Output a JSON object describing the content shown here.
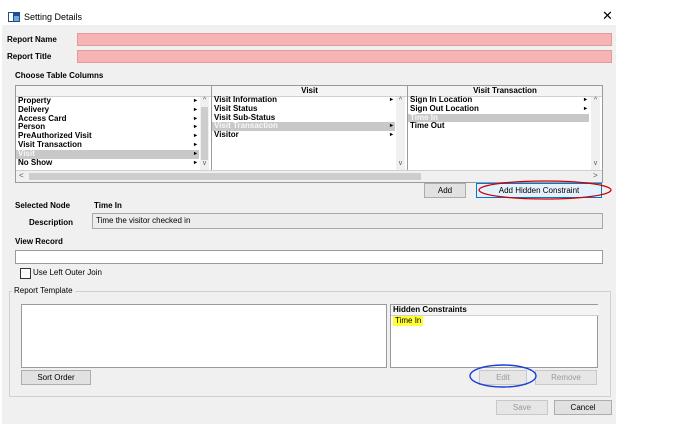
{
  "window": {
    "title": "Setting Details"
  },
  "form": {
    "report_name_label": "Report Name",
    "report_title_label": "Report Title",
    "choose_columns_label": "Choose Table Columns"
  },
  "columns": {
    "left": {
      "items": [
        {
          "label": "Property",
          "arrow": "▸",
          "selected": false
        },
        {
          "label": "Delivery",
          "arrow": "▸",
          "selected": false
        },
        {
          "label": "Access Card",
          "arrow": "▸",
          "selected": false
        },
        {
          "label": "Person",
          "arrow": "▸",
          "selected": false
        },
        {
          "label": "PreAuthorized Visit",
          "arrow": "▸",
          "selected": false
        },
        {
          "label": "Visit Transaction",
          "arrow": "▸",
          "selected": false
        },
        {
          "label": "Visit",
          "arrow": "▸",
          "selected": true
        },
        {
          "label": "No Show",
          "arrow": "▸",
          "selected": false
        }
      ]
    },
    "middle": {
      "header": "Visit",
      "items": [
        {
          "label": "Visit Information",
          "arrow": "▸",
          "selected": false
        },
        {
          "label": "Visit Status",
          "arrow": "",
          "selected": false
        },
        {
          "label": "Visit Sub-Status",
          "arrow": "",
          "selected": false
        },
        {
          "label": "Visit Transaction",
          "arrow": "▸",
          "selected": true
        },
        {
          "label": "Visitor",
          "arrow": "▸",
          "selected": false
        }
      ]
    },
    "right": {
      "header": "Visit Transaction",
      "items": [
        {
          "label": "Sign In Location",
          "arrow": "▸",
          "selected": false
        },
        {
          "label": "Sign Out Location",
          "arrow": "▸",
          "selected": false
        },
        {
          "label": "Time In",
          "arrow": "",
          "selected": true
        },
        {
          "label": "Time Out",
          "arrow": "",
          "selected": false
        }
      ]
    }
  },
  "buttons": {
    "add": "Add",
    "add_hidden_constraint": "Add Hidden Constraint",
    "sort_order": "Sort Order",
    "edit": "Edit",
    "remove": "Remove",
    "save": "Save",
    "cancel": "Cancel"
  },
  "selected_node": {
    "label": "Selected Node",
    "value": "Time In"
  },
  "description": {
    "label": "Description",
    "value": "Time the visitor checked in"
  },
  "view_record": {
    "label": "View Record"
  },
  "left_outer_join": {
    "label": "Use Left Outer Join",
    "checked": false
  },
  "report_template": {
    "legend": "Report Template",
    "hidden_constraints_header": "Hidden Constraints",
    "hidden_constraints": [
      "Time In"
    ]
  },
  "colors": {
    "pink_field": "#f5b5b5",
    "highlight": "#ffff33",
    "annotation_red": "#cc0000",
    "annotation_blue": "#1a3fd6"
  }
}
